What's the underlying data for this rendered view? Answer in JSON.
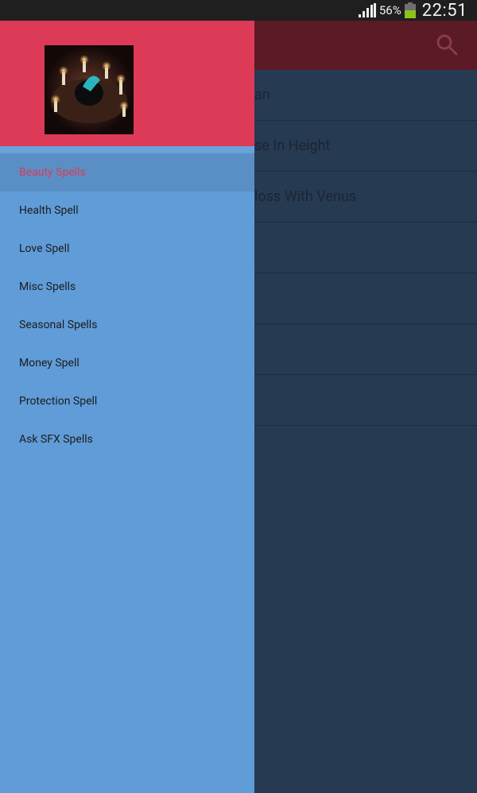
{
  "status_bar": {
    "battery_percent": "56%",
    "time": "22:51"
  },
  "background": {
    "rows": [
      "an",
      "se In Height",
      "loss With Venus",
      "",
      "",
      "",
      ""
    ]
  },
  "drawer": {
    "menu": [
      {
        "label": "Beauty Spells",
        "active": true
      },
      {
        "label": "Health Spell",
        "active": false
      },
      {
        "label": "Love Spell",
        "active": false
      },
      {
        "label": "Misc Spells",
        "active": false
      },
      {
        "label": "Seasonal Spells",
        "active": false
      },
      {
        "label": "Money Spell",
        "active": false
      },
      {
        "label": "Protection Spell",
        "active": false
      },
      {
        "label": "Ask SFX Spells",
        "active": false
      }
    ]
  },
  "colors": {
    "drawer_header": "#dc3a56",
    "drawer_body": "#609cd8",
    "active_text": "#dc3a56",
    "app_bar": "#5a1a26",
    "list_bg": "#263a52"
  }
}
